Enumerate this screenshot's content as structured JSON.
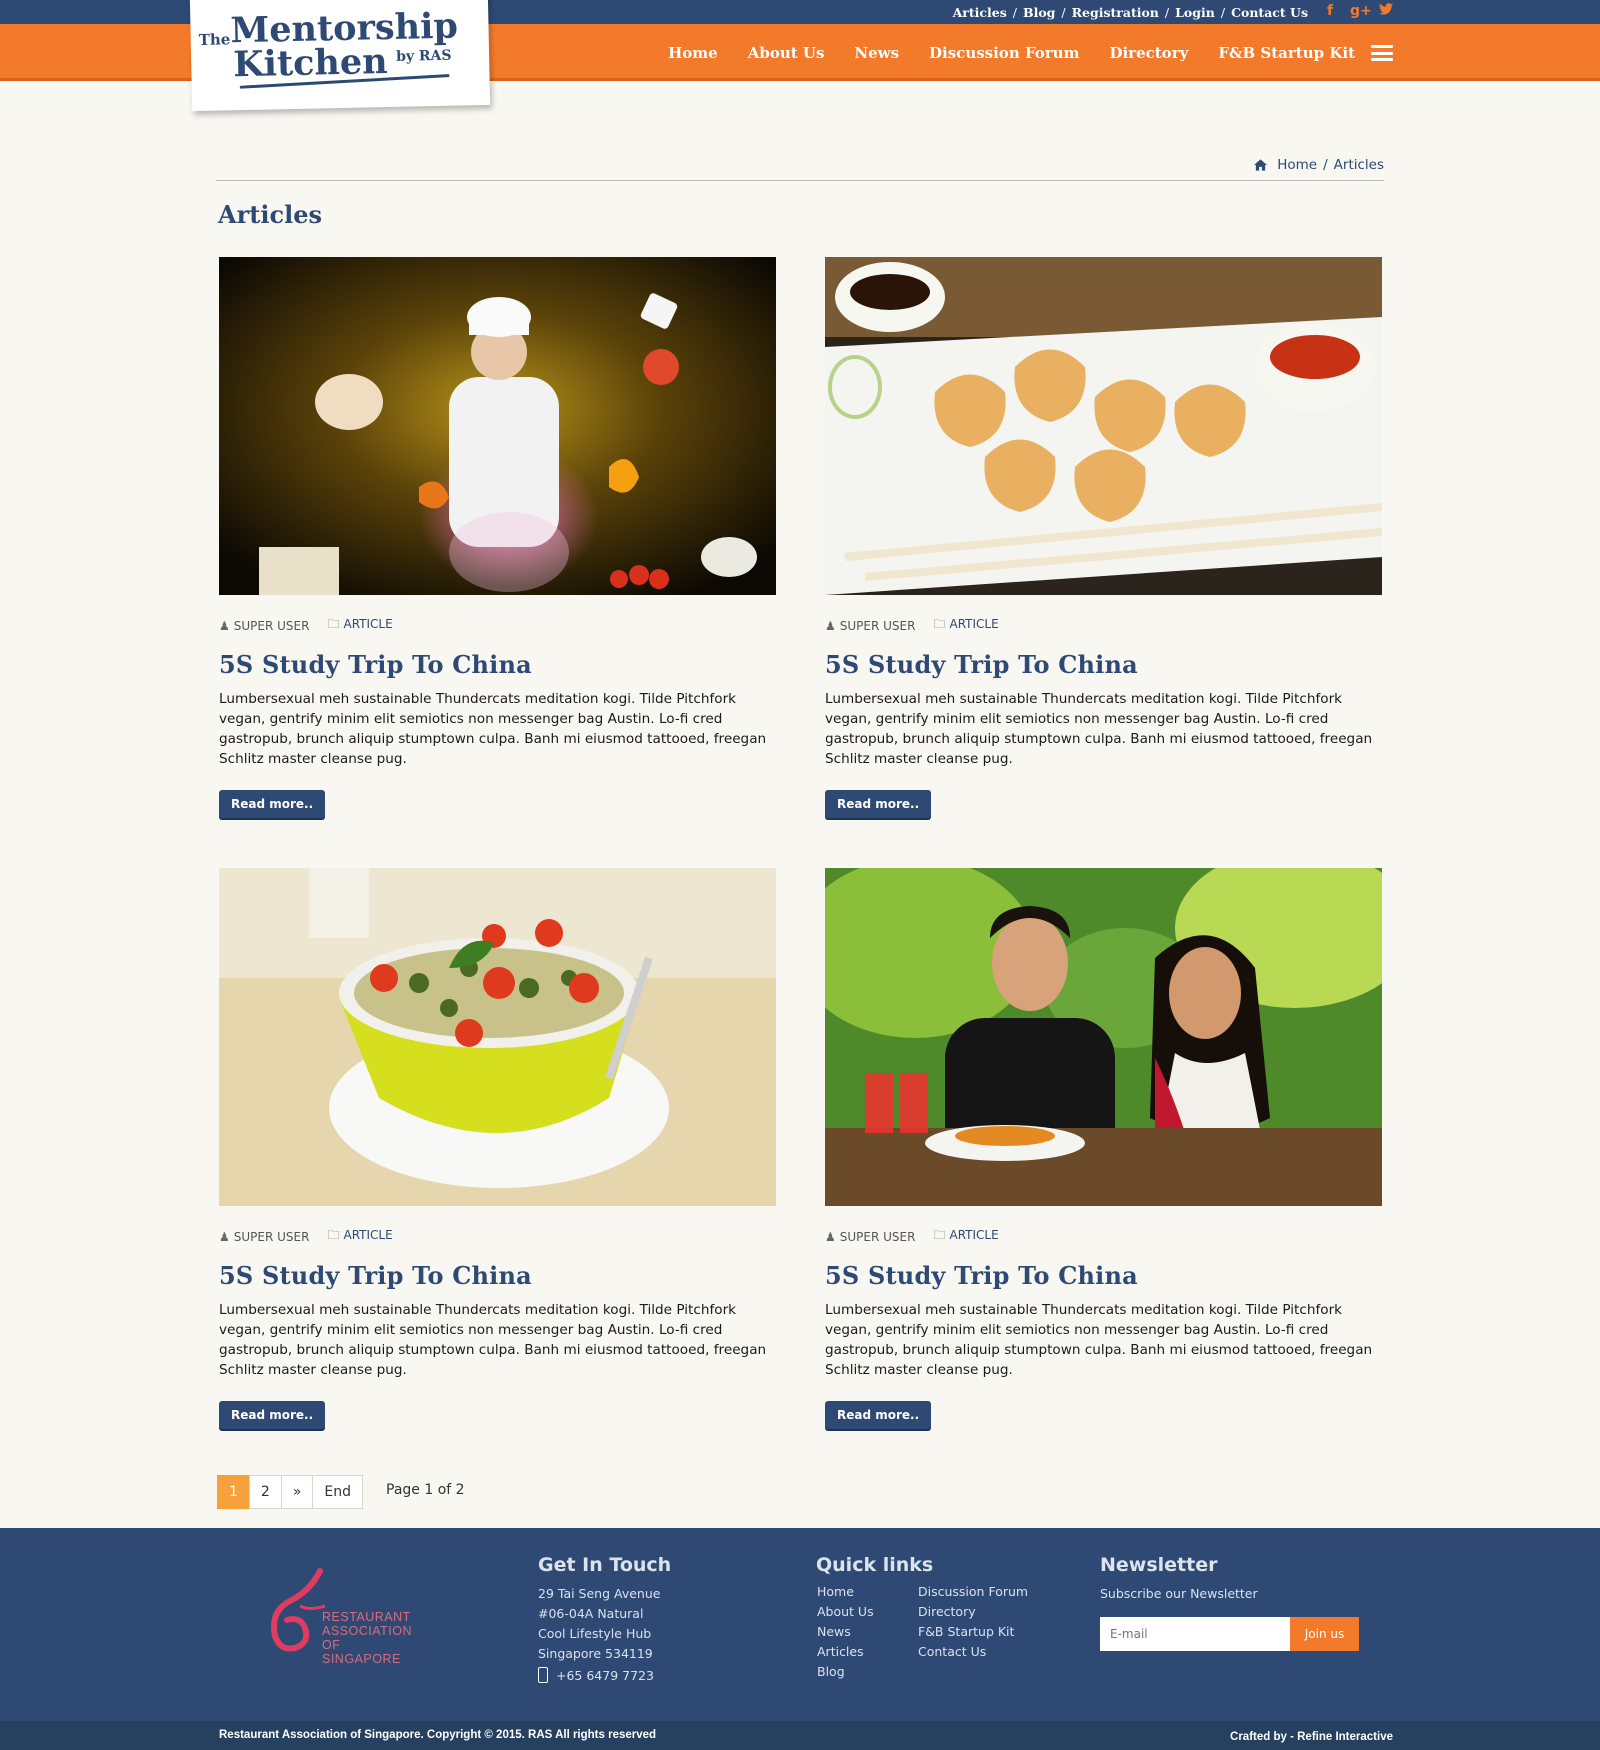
{
  "header": {
    "top_links": [
      "Articles",
      "Blog",
      "Registration",
      "Login",
      "Contact Us"
    ],
    "nav": [
      "Home",
      "About Us",
      "News",
      "Discussion Forum",
      "Directory",
      "F&B Startup Kit"
    ],
    "logo": {
      "the": "The",
      "line1": "Mentorship",
      "line2": "Kitchen",
      "by": "by RAS"
    },
    "social_icons": [
      "facebook-icon",
      "google-plus-icon",
      "twitter-icon"
    ]
  },
  "breadcrumb": {
    "home": "Home",
    "sep": "/",
    "current": "Articles"
  },
  "page_title": "Articles",
  "articles": [
    {
      "author": "SUPER USER",
      "category": "ARTICLE",
      "title": "5S Study Trip To China",
      "excerpt": "Lumbersexual meh sustainable Thundercats meditation kogi. Tilde Pitchfork vegan, gentrify minim elit semiotics non messenger bag Austin. Lo-fi cred gastropub, brunch aliquip stumptown culpa. Banh mi eiusmod tattooed, freegan Schlitz master cleanse pug.",
      "button": "Read more..",
      "image": "chef-photo"
    },
    {
      "author": "SUPER USER",
      "category": "ARTICLE",
      "title": "5S Study Trip To China",
      "excerpt": "Lumbersexual meh sustainable Thundercats meditation kogi. Tilde Pitchfork vegan, gentrify minim elit semiotics non messenger bag Austin. Lo-fi cred gastropub, brunch aliquip stumptown culpa. Banh mi eiusmod tattooed, freegan Schlitz master cleanse pug.",
      "button": "Read more..",
      "image": "dumplings-photo"
    },
    {
      "author": "SUPER USER",
      "category": "ARTICLE",
      "title": "5S Study Trip To China",
      "excerpt": "Lumbersexual meh sustainable Thundercats meditation kogi. Tilde Pitchfork vegan, gentrify minim elit semiotics non messenger bag Austin. Lo-fi cred gastropub, brunch aliquip stumptown culpa. Banh mi eiusmod tattooed, freegan Schlitz master cleanse pug.",
      "button": "Read more..",
      "image": "pasta-bowl-photo"
    },
    {
      "author": "SUPER USER",
      "category": "ARTICLE",
      "title": "5S Study Trip To China",
      "excerpt": "Lumbersexual meh sustainable Thundercats meditation kogi. Tilde Pitchfork vegan, gentrify minim elit semiotics non messenger bag Austin. Lo-fi cred gastropub, brunch aliquip stumptown culpa. Banh mi eiusmod tattooed, freegan Schlitz master cleanse pug.",
      "button": "Read more..",
      "image": "couple-dining-photo"
    }
  ],
  "pagination": {
    "pages": [
      "1",
      "2",
      "»",
      "End"
    ],
    "active": "1",
    "info": "Page 1 of 2"
  },
  "footer": {
    "logo_lines": [
      "RESTAURANT",
      "ASSOCIATION OF",
      "SINGAPORE"
    ],
    "contact": {
      "heading": "Get In Touch",
      "address": [
        "29 Tai Seng Avenue",
        "#06-04A Natural",
        "Cool Lifestyle Hub",
        "Singapore 534119"
      ],
      "phone": "+65 6479 7723"
    },
    "quicklinks": {
      "heading": "Quick links",
      "col1": [
        "Home",
        "About Us",
        "News",
        "Articles",
        "Blog"
      ],
      "col2": [
        "Discussion Forum",
        "Directory",
        "F&B Startup Kit",
        "Contact Us"
      ]
    },
    "newsletter": {
      "heading": "Newsletter",
      "subtitle": "Subscribe our Newsletter",
      "placeholder": "E-mail",
      "button": "Join us"
    },
    "copyright": "Restaurant Association of Singapore. Copyright © 2015. RAS All rights reserved",
    "crafted": "Crafted by - Refine Interactive"
  },
  "colors": {
    "navy": "#2e4a74",
    "orange": "#f47a2b",
    "page_bg": "#f8f7f1",
    "pager_active": "#f8a13b"
  }
}
